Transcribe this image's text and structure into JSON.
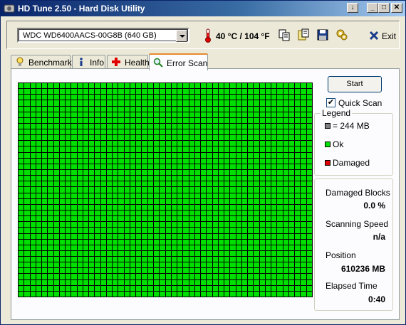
{
  "window": {
    "title": "HD Tune 2.50 - Hard Disk Utility",
    "controls": {
      "help": "↓",
      "minimize": "_",
      "maximize": "□",
      "close": "✕"
    }
  },
  "toolbar": {
    "drive": "WDC WD6400AACS-00G8B (640 GB)",
    "temperature": "40 °C / 104 °F",
    "icons": [
      "copy-icon",
      "copy-info-icon",
      "save-icon",
      "options-icon"
    ],
    "exit_label": "Exit"
  },
  "tabs": [
    {
      "label": "Benchmark",
      "icon": "benchmark-icon",
      "active": false
    },
    {
      "label": "Info",
      "icon": "info-icon",
      "active": false
    },
    {
      "label": "Health",
      "icon": "health-icon",
      "active": false
    },
    {
      "label": "Error Scan",
      "icon": "magnifier-icon",
      "active": true
    }
  ],
  "scan": {
    "start_label": "Start",
    "quick_scan_label": "Quick Scan",
    "quick_scan_checked": true,
    "block_state": "ok"
  },
  "legend": {
    "title": "Legend",
    "items": [
      {
        "label": "= 244 MB",
        "color": "#808080"
      },
      {
        "label": "Ok",
        "color": "#00e000"
      },
      {
        "label": "Damaged",
        "color": "#e00000"
      }
    ]
  },
  "stats": {
    "damaged_blocks_label": "Damaged Blocks",
    "damaged_blocks_value": "0.0 %",
    "scanning_speed_label": "Scanning Speed",
    "scanning_speed_value": "n/a",
    "position_label": "Position",
    "position_value": "610236 MB",
    "elapsed_label": "Elapsed Time",
    "elapsed_value": "0:40"
  },
  "colors": {
    "ok": "#00e000",
    "damaged": "#e00000",
    "block_size": "#808080"
  }
}
